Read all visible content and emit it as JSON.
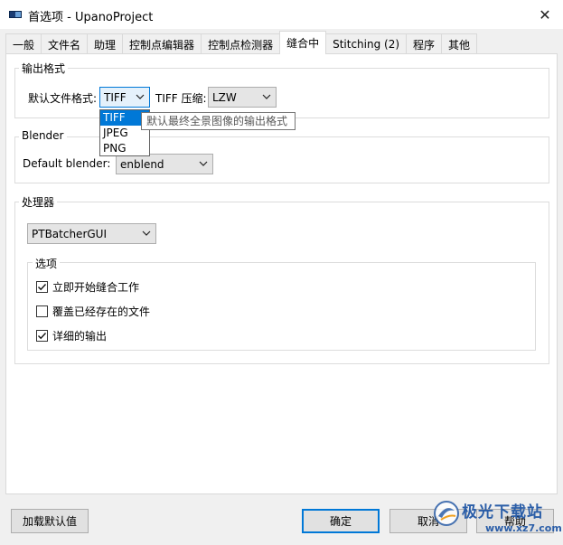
{
  "window": {
    "title": "首选项 - UpanoProject",
    "close_glyph": "✕"
  },
  "tabs": [
    {
      "label": "一般"
    },
    {
      "label": "文件名"
    },
    {
      "label": "助理"
    },
    {
      "label": "控制点编辑器"
    },
    {
      "label": "控制点检测器"
    },
    {
      "label": "缝合中",
      "active": true
    },
    {
      "label": "Stitching (2)"
    },
    {
      "label": "程序"
    },
    {
      "label": "其他"
    }
  ],
  "output_format": {
    "group_title": "输出格式",
    "format_label": "默认文件格式:",
    "format_value": "TIFF",
    "compression_label": "TIFF 压缩:",
    "compression_value": "LZW",
    "dropdown_options": [
      "TIFF",
      "JPEG",
      "PNG"
    ],
    "tooltip": "默认最终全景图像的输出格式"
  },
  "blender": {
    "group_title": "Blender",
    "label": "Default blender:",
    "value": "enblend"
  },
  "processor": {
    "group_title": "处理器",
    "value": "PTBatcherGUI",
    "options_title": "选项",
    "options": [
      {
        "label": "立即开始缝合工作",
        "checked": true
      },
      {
        "label": "覆盖已经存在的文件",
        "checked": false
      },
      {
        "label": "详细的输出",
        "checked": true
      }
    ]
  },
  "buttons": {
    "load_defaults": "加载默认值",
    "ok": "确定",
    "cancel": "取消",
    "help": "帮助"
  },
  "watermark": {
    "text": "极光下载站",
    "url": "www.xz7.com"
  },
  "colors": {
    "accent": "#0078d7",
    "panel": "#ffffff",
    "window": "#f0f0f0"
  }
}
